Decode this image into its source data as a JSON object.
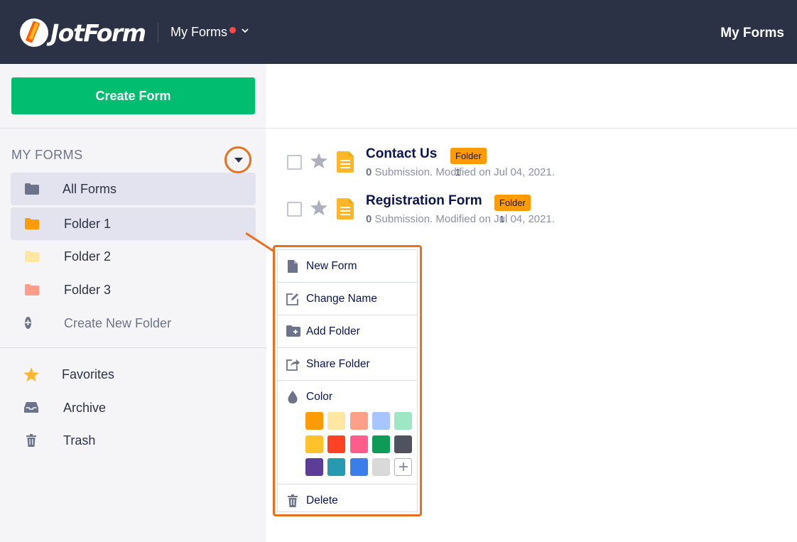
{
  "header": {
    "logo_text": "JotForm",
    "nav_label": "My Forms",
    "right_title": "My Forms"
  },
  "sidebar": {
    "create_button": "Create Form",
    "heading": "MY FORMS",
    "items": [
      {
        "label": "All Forms",
        "icon": "folder-icon",
        "color": "#6c738a"
      },
      {
        "label": "Folder 1",
        "icon": "folder-icon",
        "color": "#ff9b08"
      },
      {
        "label": "Folder 2",
        "icon": "folder-icon",
        "color": "#ffe6a3"
      },
      {
        "label": "Folder 3",
        "icon": "folder-icon",
        "color": "#ff9f89"
      },
      {
        "label": "Create New Folder",
        "icon": "plus-circle-icon"
      }
    ],
    "bottom_items": [
      {
        "label": "Favorites",
        "icon": "star-icon"
      },
      {
        "label": "Archive",
        "icon": "inbox-icon"
      },
      {
        "label": "Trash",
        "icon": "trash-icon"
      }
    ]
  },
  "forms": [
    {
      "title": "Contact Us",
      "folder_badge": "Folder 1",
      "count": "0",
      "meta": " Submission. Modified on Jul 04, 2021."
    },
    {
      "title": "Registration Form",
      "folder_badge": "Folder 1",
      "count": "0",
      "meta": " Submission. Modified on Jul 04, 2021."
    }
  ],
  "context_menu": {
    "items": [
      {
        "label": "New Form",
        "icon": "document-icon"
      },
      {
        "label": "Change Name",
        "icon": "edit-icon"
      },
      {
        "label": "Add Folder",
        "icon": "folder-plus-icon"
      },
      {
        "label": "Share Folder",
        "icon": "share-icon"
      },
      {
        "label": "Color",
        "icon": "droplet-icon"
      },
      {
        "label": "Delete",
        "icon": "trash-icon"
      }
    ],
    "colors": [
      [
        "#ff9b08",
        "#ffe6a3",
        "#ff9f89",
        "#a9c5ff",
        "#9de7c5"
      ],
      [
        "#ffc22c",
        "#ff4224",
        "#ff5e8d",
        "#0f9a57",
        "#51525f"
      ],
      [
        "#5c3d98",
        "#2799b3",
        "#3a7ee9",
        "#d9d9d9",
        "add"
      ]
    ]
  }
}
